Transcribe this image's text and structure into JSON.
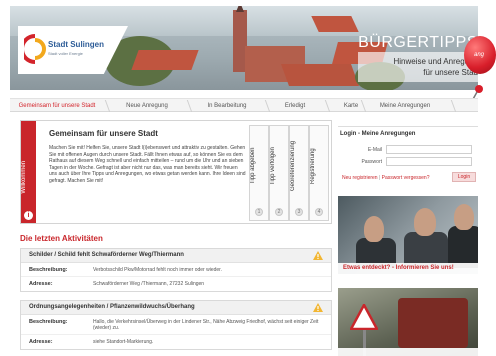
{
  "header": {
    "logo_text": "Stadt Sulingen",
    "logo_sub": "Stadt voller Energie",
    "brand": "BÜRGERTIPPS",
    "tagline_line1": "Hinweise und Anregung",
    "tagline_line2": "für unsere Stad",
    "balloon_text": "ang"
  },
  "tabs": [
    {
      "label": "Gemeinsam für unsere Stadt",
      "active": true
    },
    {
      "label": "Neue Anregung"
    },
    {
      "label": "In Bearbeitung"
    },
    {
      "label": "Erledigt"
    },
    {
      "label": "Karte"
    },
    {
      "label": "Meine Anregungen"
    }
  ],
  "welcome": {
    "side_label": "Willkommen",
    "title": "Gemeinsam für unsere Stadt",
    "body": "Machen Sie mit! Helfen Sie, unsere Stadt l(i)ebenswert und attraktiv zu gestalten. Gehen Sie mit offenen Augen durch unsere Stadt. Fällt Ihnen etwas auf, so können Sie es dem Rathaus auf diesem Weg schnell und einfach mitteilen – rund um die Uhr und an sieben Tagen in der Woche. Gefragt ist aber nicht nur das, was man bereits sieht. Wir freuen uns auch über Ihre Tipps und Anregungen, wo etwas getan werden kann. Ihre Ideen sind gefragt. Machen Sie mit!",
    "info_glyph": "i",
    "steps": [
      {
        "label": "Tipp abgeben",
        "num": "1"
      },
      {
        "label": "Tipp verfolgen",
        "num": "2"
      },
      {
        "label": "Georeferenzierung",
        "num": "3"
      },
      {
        "label": "Registrierung",
        "num": "4"
      }
    ]
  },
  "activities": {
    "heading": "Die letzten Aktivitäten",
    "items": [
      {
        "title": "Schilder / Schild fehlt Schwaförderner Weg/Thiermann",
        "desc_key": "Beschreibung:",
        "desc_val": "Verbotsschild Pkw/Motorrad fehlt noch immer oder wieder.",
        "addr_key": "Adresse:",
        "addr_val": "Schwaförderner Weg /Thiermann, 27232 Sulingen"
      },
      {
        "title": "Ordnungsangelegenheiten / Pflanzenwildwuchs/Überhang",
        "desc_key": "Beschreibung:",
        "desc_val": "Hallo, die Verkehrsinsel/Überweg in der Lindener Str., Nähe Abzweig Friedhof, wächst seit einiger Zeit (wieder) zu.",
        "addr_key": "Adresse:",
        "addr_val": "siehe Standort-Markierung."
      }
    ]
  },
  "login": {
    "title": "Login - Meine Anregungen",
    "email_label": "E-Mail",
    "password_label": "Passwort",
    "register_link": "Neu registrieren",
    "link_separator": "|",
    "forgot_link": "Passwort vergessen?",
    "submit_label": "Login"
  },
  "teasers": [
    {
      "caption": "Etwas entdeckt? - Informieren Sie uns!"
    },
    {
      "caption": ""
    }
  ],
  "colors": {
    "accent": "#c9262b",
    "tab_bg": "#f4f4f4",
    "border": "#d4d4d4"
  }
}
